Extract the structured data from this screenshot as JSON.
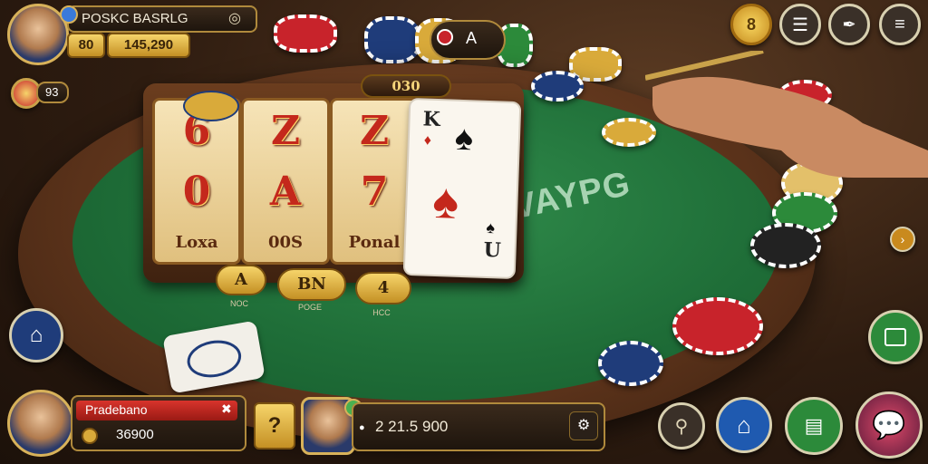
{
  "top_left": {
    "player_name": "POSKC BASRLG",
    "level": "80",
    "coins": "145,290",
    "gem_count": "93"
  },
  "top_center": {
    "pot_icon_letter": "A"
  },
  "slot": {
    "jackpot_label": "030",
    "reels": [
      {
        "top": "6",
        "middle": "0",
        "bottom_label": "Loxa"
      },
      {
        "top": "Z",
        "middle": "A",
        "bottom_label": "00S"
      },
      {
        "top": "Z",
        "middle": "7",
        "bottom_label": "Ponal"
      }
    ],
    "card": {
      "rank": "K",
      "corner_rank": "U"
    },
    "buttons": [
      {
        "label": "A",
        "caption": "NOC"
      },
      {
        "label": "BN",
        "caption": "POGE"
      },
      {
        "label": "4",
        "caption": "HCC"
      }
    ]
  },
  "felt_text": "VAYPG",
  "top_right": {
    "coin_icon_letter": "8"
  },
  "bottom_left": {
    "player_name": "Pradebano",
    "chips": "36900"
  },
  "bottom_center": {
    "help_label": "?",
    "bet_amount": "2 21.5 900"
  },
  "colors": {
    "felt": "#1f6e38",
    "wood": "#5a321a",
    "gold": "#c9a24a",
    "chip_red": "#c8232b",
    "chip_blue": "#1f3c7a",
    "action_green": "#2c8a3a"
  }
}
